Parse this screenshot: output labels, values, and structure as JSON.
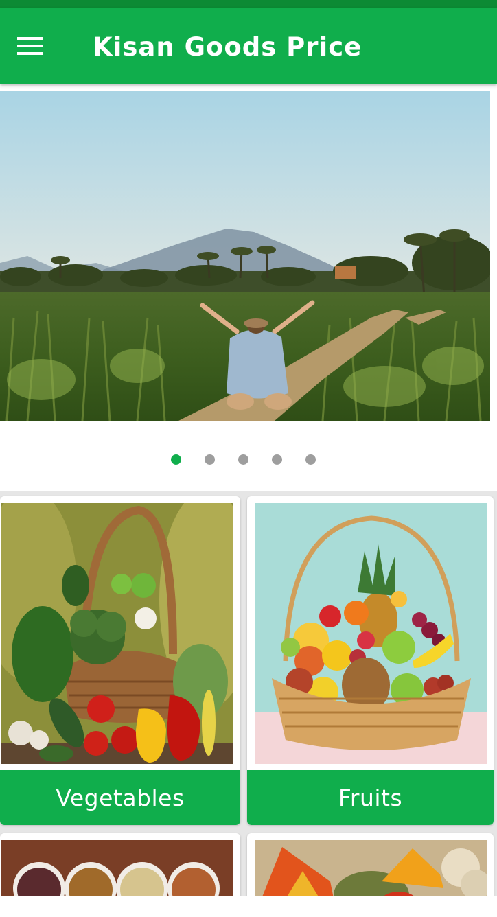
{
  "app_bar": {
    "title": "Kisan Goods Price",
    "menu_icon": "hamburger-menu-icon"
  },
  "carousel": {
    "slide_count": 5,
    "active_index": 0,
    "current_slide": "farmer-in-field-photo"
  },
  "categories": [
    {
      "label": "Vegetables",
      "image": "vegetable-basket-photo"
    },
    {
      "label": "Fruits",
      "image": "fruit-basket-photo"
    },
    {
      "label": "",
      "image": "grains-bowls-photo"
    },
    {
      "label": "",
      "image": "spices-photo"
    }
  ],
  "colors": {
    "primary": "#10ae4c",
    "status_bar": "#0c8a34",
    "dot_inactive": "#9e9e9e",
    "grid_background": "#e6e6e6"
  }
}
